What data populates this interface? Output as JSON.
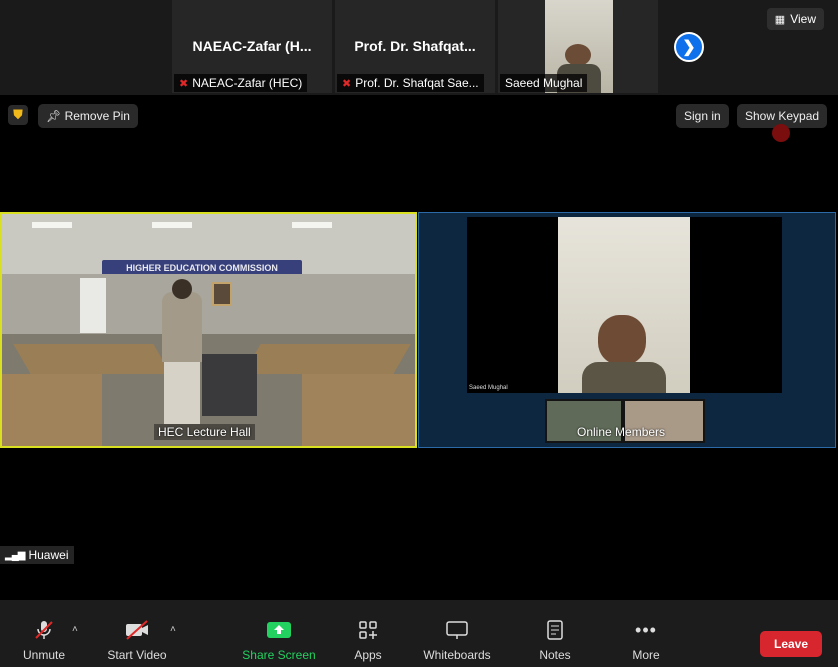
{
  "top_strip": {
    "view_label": "View",
    "thumbnails": [
      {
        "big_name": "NAEAC-Zafar (H...",
        "name_tag": "NAEAC-Zafar (HEC)",
        "muted": true
      },
      {
        "big_name": "Prof. Dr. Shafqat...",
        "name_tag": "Prof. Dr. Shafqat Sae...",
        "muted": true
      },
      {
        "big_name": "",
        "name_tag": "Saeed Mughal",
        "muted": false
      }
    ]
  },
  "toolbar2": {
    "remove_pin_label": "Remove Pin",
    "sign_in_label": "Sign in",
    "show_keypad_label": "Show Keypad"
  },
  "videos": {
    "left_label": "HEC Lecture Hall",
    "banner_text": "HIGHER EDUCATION COMMISSION",
    "right_inner_name": "Saeed Mughal",
    "right_label": "Online Members"
  },
  "network_name": "Huawei",
  "controls": {
    "unmute": "Unmute",
    "start_video": "Start Video",
    "share_screen": "Share Screen",
    "apps": "Apps",
    "whiteboards": "Whiteboards",
    "notes": "Notes",
    "more": "More",
    "leave": "Leave"
  },
  "colors": {
    "accent_green": "#23d160",
    "leave_red": "#d7262d",
    "active_border": "#d9e021",
    "next_blue": "#0e71eb"
  }
}
